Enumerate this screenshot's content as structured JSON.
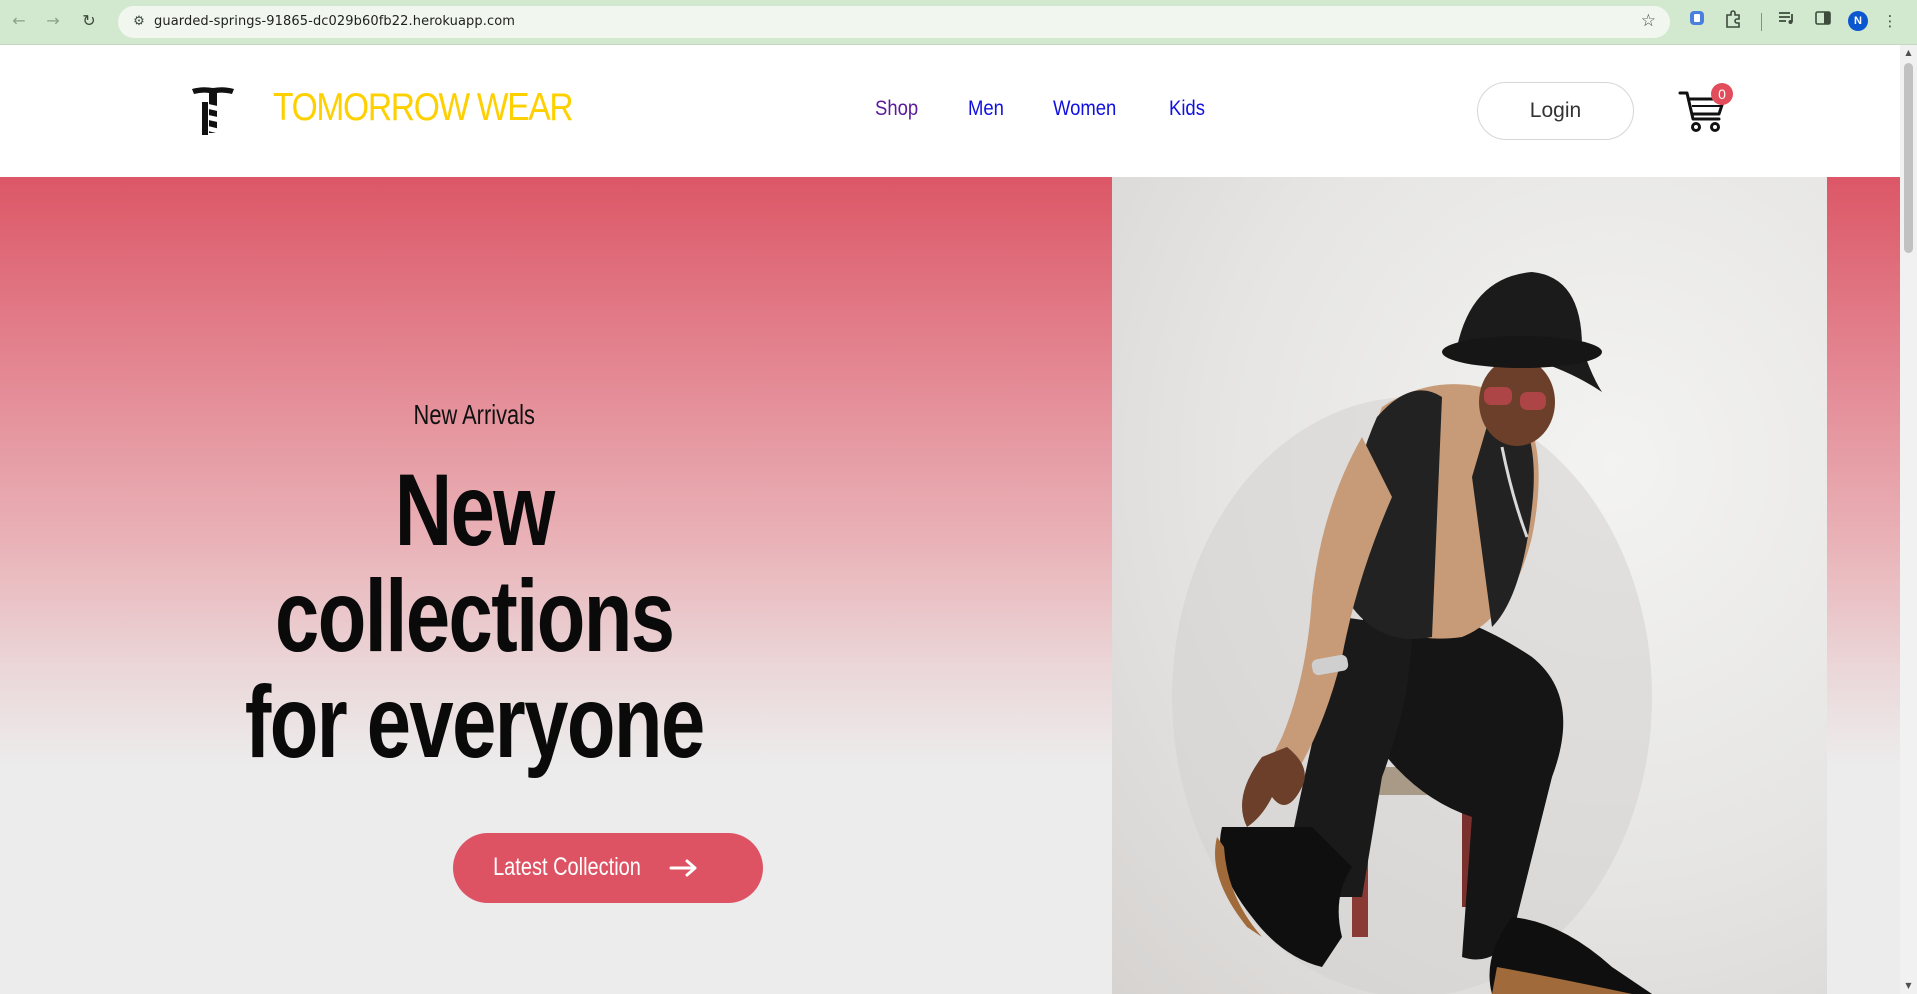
{
  "browser": {
    "url": "guarded-springs-91865-dc029b60fb22.herokuapp.com",
    "profile_initial": "N",
    "icons": {
      "back": "arrow-left-icon",
      "forward": "arrow-right-icon",
      "reload": "reload-icon",
      "site_info": "tune-icon",
      "bookmark": "star-icon",
      "extensions": "puzzle-icon",
      "media": "media-queue-icon",
      "side_panel": "side-panel-icon",
      "menu": "kebab-menu-icon"
    }
  },
  "header": {
    "brand": "TOMORROW WEAR",
    "brand_color": "#ffd000",
    "nav": [
      "Shop",
      "Men",
      "Women",
      "Kids"
    ],
    "login_label": "Login",
    "cart_count": "0",
    "badge_color": "#e14d5b"
  },
  "hero": {
    "kicker": "New Arrivals",
    "headline_lines": [
      "New",
      "collections",
      "for everyone"
    ],
    "cta_label": "Latest Collection",
    "accent_color": "#dd5363"
  }
}
